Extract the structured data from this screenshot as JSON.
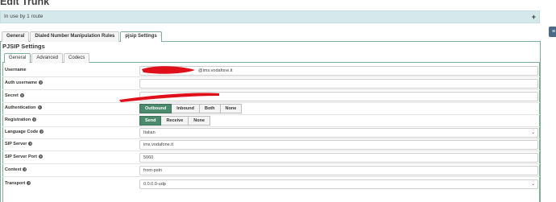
{
  "page_title": "Edit Trunk",
  "usage": {
    "text": "In use by 1 route",
    "expand_icon": "+"
  },
  "tabs": [
    {
      "label": "General",
      "active": false
    },
    {
      "label": "Dialed Number Manipulation Rules",
      "active": false
    },
    {
      "label": "pjsip Settings",
      "active": true
    }
  ],
  "section_title": "PJSIP Settings",
  "subtabs": [
    {
      "label": "General",
      "active": true
    },
    {
      "label": "Advanced",
      "active": false
    },
    {
      "label": "Codecs",
      "active": false
    }
  ],
  "form": {
    "username": {
      "label": "Username",
      "value": "@ims.vodafone.it"
    },
    "auth_username": {
      "label": "Auth username",
      "value": ""
    },
    "secret": {
      "label": "Secret",
      "value": ""
    },
    "authentication": {
      "label": "Authentication",
      "options": [
        "Outbound",
        "Inbound",
        "Both",
        "None"
      ],
      "selected": "Outbound"
    },
    "registration": {
      "label": "Registration",
      "options": [
        "Send",
        "Receive",
        "None"
      ],
      "selected": "Send"
    },
    "language_code": {
      "label": "Language Code",
      "value": "Italian"
    },
    "sip_server": {
      "label": "SIP Server",
      "value": "ims.vodafone.it"
    },
    "sip_server_port": {
      "label": "SIP Server Port",
      "value": "5060"
    },
    "context": {
      "label": "Context",
      "value": "from-pstn"
    },
    "transport": {
      "label": "Transport",
      "value": "0.0.0.0-udp"
    }
  },
  "colors": {
    "accent": "#4b8a6c",
    "header_bar": "#d5e9ec",
    "redaction": "#e0101a"
  },
  "icons": {
    "help": "?",
    "chevron": "⌄",
    "side_panel": "list-icon"
  }
}
